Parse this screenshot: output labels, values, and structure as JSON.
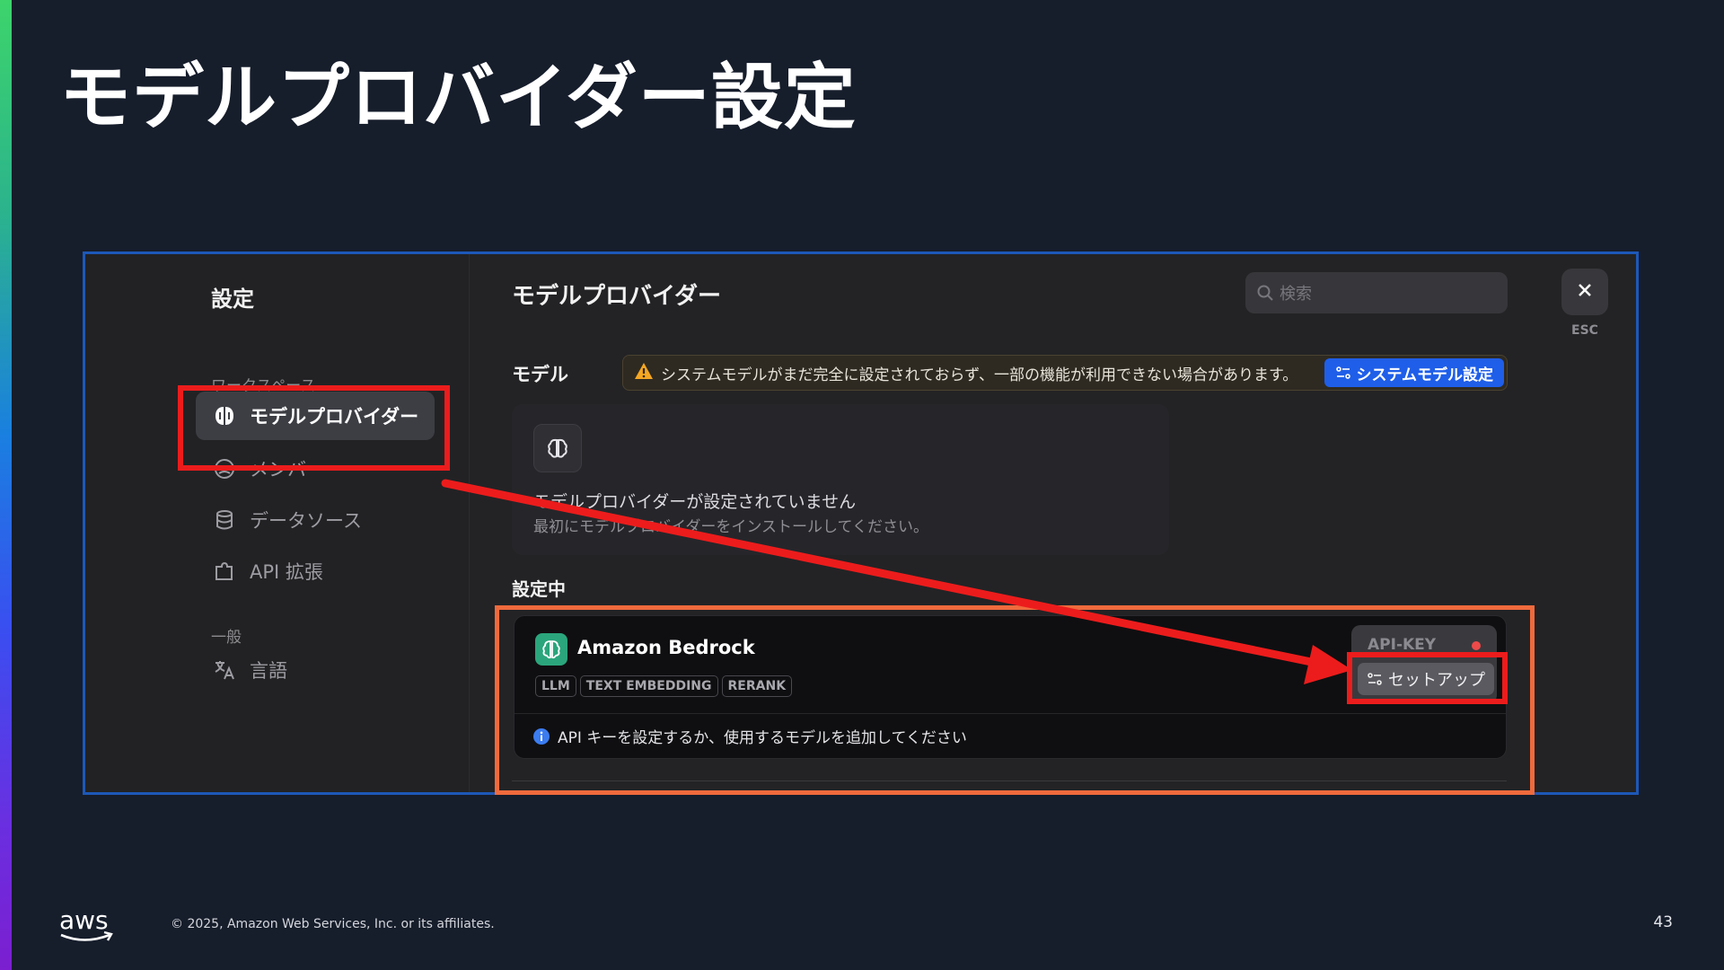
{
  "slide": {
    "title": "モデルプロバイダー設定",
    "copyright": "© 2025, Amazon Web Services, Inc. or its affiliates.",
    "page_number": "43",
    "logo_text": "aws"
  },
  "settings": {
    "sidebar": {
      "title": "設定",
      "workspace_section": "ワークスペース",
      "general_section": "一般",
      "items": [
        {
          "label": "モデルプロバイダー",
          "icon": "brain-icon",
          "active": true
        },
        {
          "label": "メンバー",
          "icon": "members-icon",
          "active": false
        },
        {
          "label": "データソース",
          "icon": "database-icon",
          "active": false
        },
        {
          "label": "API 拡張",
          "icon": "puzzle-icon",
          "active": false
        }
      ],
      "general_items": [
        {
          "label": "言語",
          "icon": "translate-icon"
        }
      ]
    },
    "main": {
      "title": "モデルプロバイダー",
      "search_placeholder": "検索",
      "close_hint": "ESC",
      "model_label": "モデル",
      "warning_text": "システムモデルがまだ完全に設定されておらず、一部の機能が利用できない場合があります。",
      "system_model_button": "システムモデル設定",
      "empty_title": "モデルプロバイダーが設定されていません",
      "empty_desc": "最初にモデルプロバイダーをインストールしてください。",
      "configured_label": "設定中",
      "provider": {
        "name": "Amazon Bedrock",
        "tags": [
          "LLM",
          "TEXT EMBEDDING",
          "RERANK"
        ],
        "api_key_label": "API-KEY",
        "setup_button": "セットアップ",
        "info_text": "API キーを設定するか、使用するモデルを追加してください"
      }
    }
  },
  "colors": {
    "accent_blue": "#1f5ee8",
    "annotation_red": "#ec1c1c",
    "annotation_orange": "#ef6a3d",
    "status_red": "#ee4a4a",
    "provider_green": "#2ba57c"
  }
}
